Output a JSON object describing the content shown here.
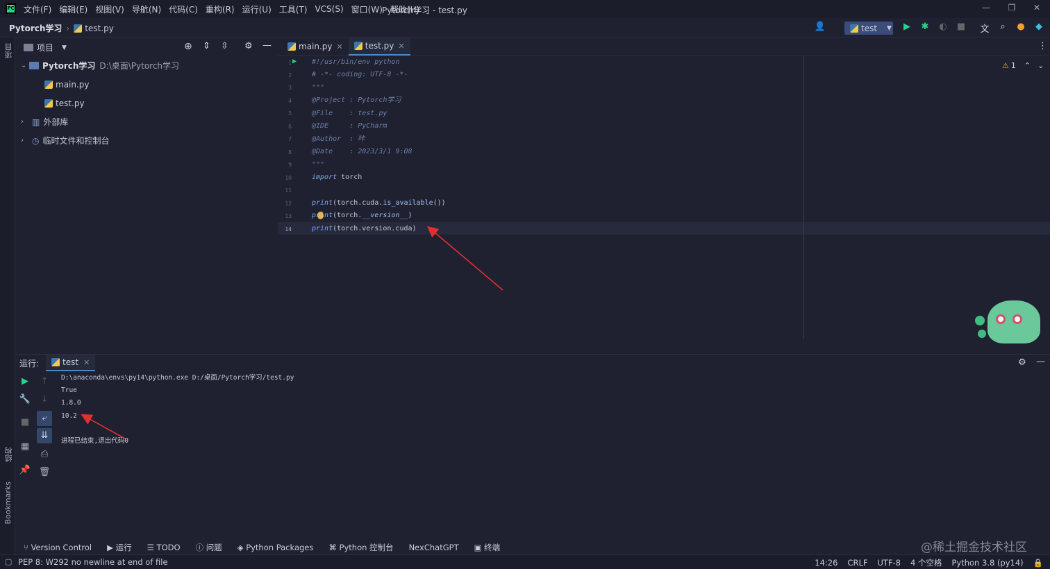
{
  "menubar": {
    "logo": "PC",
    "items": [
      "文件(F)",
      "编辑(E)",
      "视图(V)",
      "导航(N)",
      "代码(C)",
      "重构(R)",
      "运行(U)",
      "工具(T)",
      "VCS(S)",
      "窗口(W)",
      "帮助(H)"
    ],
    "window_title": "Pytorch学习 - test.py"
  },
  "navbar": {
    "project": "Pytorch学习",
    "file": "test.py",
    "run_config": "test"
  },
  "left_strip": {
    "project_label": "项目",
    "structure_label": "结构",
    "bookmarks_label": "Bookmarks"
  },
  "project_panel": {
    "header": "项目",
    "root_name": "Pytorch学习",
    "root_path": "D:\\桌面\\Pytorch学习",
    "files": [
      "main.py",
      "test.py"
    ],
    "external_libs": "外部库",
    "scratches": "临时文件和控制台"
  },
  "editor": {
    "tabs": [
      {
        "label": "main.py",
        "active": false
      },
      {
        "label": "test.py",
        "active": true
      }
    ],
    "line_numbers": [
      "1",
      "2",
      "3",
      "4",
      "5",
      "6",
      "7",
      "8",
      "9",
      "10",
      "11",
      "12",
      "13",
      "14"
    ],
    "lines": {
      "l1": "#!/usr/bin/env python",
      "l2": "# -*- coding: UTF-8 -*-",
      "l3": "\"\"\"",
      "l4a": "@Project ",
      "l4b": ": Pytorch学习",
      "l5a": "@File    ",
      "l5b": ": test.py",
      "l6a": "@IDE     ",
      "l6b": ": PyCharm",
      "l7a": "@Author  ",
      "l7b": ": 咔",
      "l8a": "@Date    ",
      "l8b": ": 2023/3/1 9:08",
      "l9": "\"\"\"",
      "l10_kw": "import",
      "l10_rest": " torch",
      "l12_fn": "print",
      "l12_a": "(torch.cuda.",
      "l12_b": "is_available",
      "l12_c": "())",
      "l13_fn": "print",
      "l13_a": "(torch.",
      "l13_b": "__version__",
      "l13_c": ")",
      "l14_fn": "print",
      "l14_a": "(torch.version.cuda)"
    },
    "inspection_count": "1"
  },
  "run_panel": {
    "label": "运行:",
    "tab": "test",
    "output": [
      "D:\\anaconda\\envs\\py14\\python.exe D:/桌面/Pytorch学习/test.py",
      "True",
      "1.8.0",
      "10.2",
      "",
      "进程已结束,退出代码0"
    ]
  },
  "bottom_toolbar": {
    "items": [
      "Version Control",
      "运行",
      "TODO",
      "问题",
      "Python Packages",
      "Python 控制台",
      "NexChatGPT",
      "终端"
    ]
  },
  "statusbar": {
    "message": "PEP 8: W292 no newline at end of file",
    "position": "14:26",
    "line_sep": "CRLF",
    "encoding": "UTF-8",
    "indent": "4 个空格",
    "interpreter": "Python 3.8 (py14)"
  },
  "watermark": "@稀土掘金技术社区",
  "colors": {
    "accent": "#4a88c7",
    "run_green": "#21d789",
    "annotation_red": "#e03030"
  }
}
